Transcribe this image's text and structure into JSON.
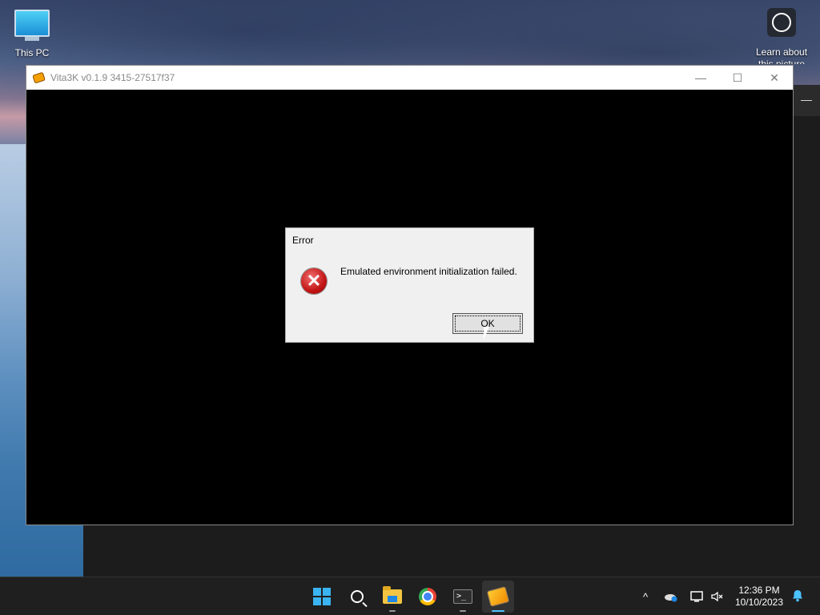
{
  "desktop": {
    "icons": [
      {
        "label": "This PC"
      },
      {
        "label": "Learn about this picture"
      }
    ]
  },
  "background_window": {
    "button_label": "—"
  },
  "vita_window": {
    "title": "Vita3K v0.1.9 3415-27517f37",
    "minimize_label": "—",
    "maximize_label": "☐",
    "close_label": "✕"
  },
  "dialog": {
    "title": "Error",
    "message": "Emulated environment initialization failed.",
    "ok_label": "OK",
    "icon": "error-icon"
  },
  "taskbar": {
    "apps": [
      {
        "name": "start",
        "icon": "windows-logo-icon"
      },
      {
        "name": "search",
        "icon": "search-icon"
      },
      {
        "name": "file-explorer",
        "icon": "folder-icon"
      },
      {
        "name": "chrome",
        "icon": "chrome-icon"
      },
      {
        "name": "terminal",
        "icon": "terminal-icon",
        "label": ">_"
      },
      {
        "name": "vita3k",
        "icon": "vita3k-icon",
        "active": true
      }
    ],
    "tray": {
      "chevron": "^",
      "time": "12:36 PM",
      "date": "10/10/2023"
    }
  },
  "colors": {
    "accent": "#4cc2ff",
    "error_red": "#c41515",
    "taskbar_bg": "#1f1f1f"
  }
}
